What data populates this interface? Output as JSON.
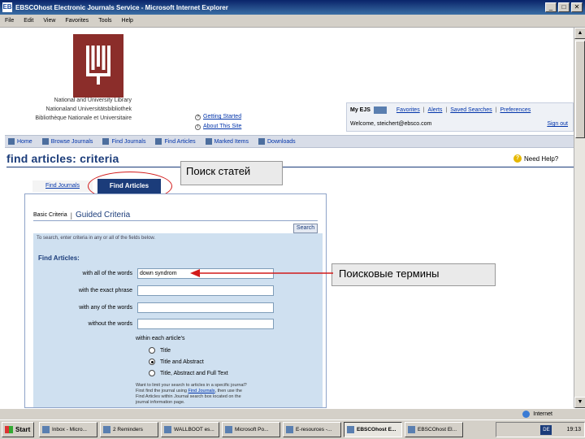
{
  "window": {
    "title": "EBSCOhost Electronic Journals Service - Microsoft Internet Explorer",
    "app_icon": "EB"
  },
  "menu": [
    "File",
    "Edit",
    "View",
    "Favorites",
    "Tools",
    "Help"
  ],
  "library": {
    "lines": [
      "National and University Library",
      "Nationaland Universitätsbibliothek",
      "Bibliothèque Nationale et Universitaire"
    ]
  },
  "help_links": {
    "getting_started": "Getting Started",
    "about": "About This Site"
  },
  "mybox": {
    "label": "My EJS",
    "favorites": "Favorites",
    "alerts": "Alerts",
    "saved_searches": "Saved Searches",
    "preferences": "Preferences",
    "welcome": "Welcome, steichert@ebsco.com",
    "sign_out": "Sign out"
  },
  "nav": [
    "Home",
    "Browse Journals",
    "Find Journals",
    "Find Articles",
    "Marked Items",
    "Downloads"
  ],
  "page_title": "find articles: criteria",
  "need_help": "Need Help?",
  "tabs": {
    "journals": "Find Journals",
    "articles": "Find Articles"
  },
  "callouts": {
    "tab": "Поиск статей",
    "terms": "Поисковые термины"
  },
  "panel": {
    "basic": "Basic Criteria",
    "guided": "Guided Criteria",
    "search": "Search",
    "instructions": "To search, enter criteria in any or all of the fields below.",
    "find_articles": "Find Articles:",
    "fields": [
      {
        "label": "with all of the words",
        "value": "down syndrom"
      },
      {
        "label": "with the exact phrase",
        "value": ""
      },
      {
        "label": "with any of the words",
        "value": ""
      },
      {
        "label": "without the words",
        "value": ""
      }
    ],
    "within_label": "within each article's",
    "radios": [
      {
        "label": "Title",
        "selected": false
      },
      {
        "label": "Title and Abstract",
        "selected": true
      },
      {
        "label": "Title, Abstract and Full Text",
        "selected": false
      }
    ],
    "journal_hint": {
      "line1": "Want to limit your search to articles in a specific journal?",
      "line2a": "First find the journal using",
      "link": "Find Journals",
      "line2b": ", then use the",
      "line3": "Find Articles within Journal search box located on the",
      "line4": "journal information page."
    }
  },
  "status": {
    "zone": "Internet"
  },
  "taskbar": {
    "start": "Start",
    "tasks": [
      "Inbox - Micro...",
      "2 Reminders",
      "WALLBOOT es...",
      "Microsoft Po...",
      "E-resources -...",
      "EBSCOhost E...",
      "EBSCOhost El..."
    ],
    "active_index": 5,
    "lang": "DE",
    "clock": "19:13"
  },
  "colors": {
    "accent": "#1b3c7a",
    "logo": "#8b2d2a",
    "form_bg": "#cfe0f0",
    "highlight": "#d21a1a"
  }
}
